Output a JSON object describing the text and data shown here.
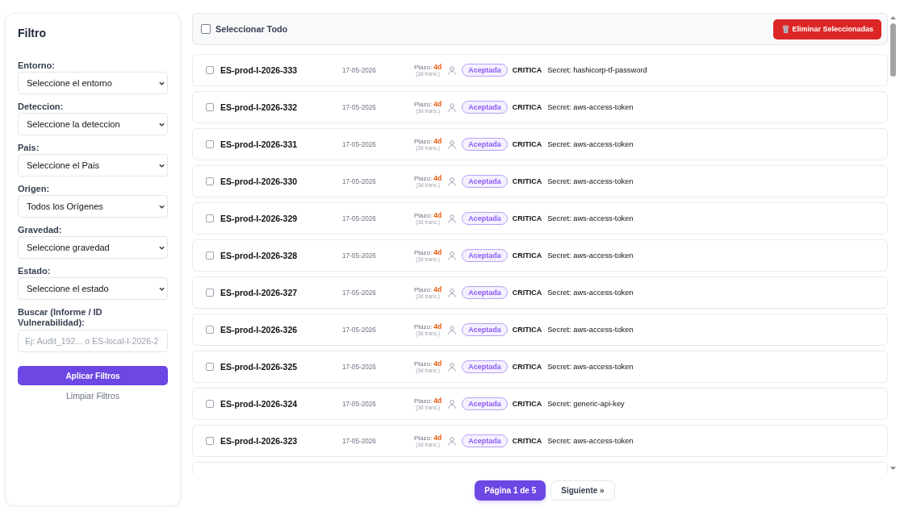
{
  "sidebar": {
    "title": "Filtro",
    "filters": [
      {
        "label": "Entorno:",
        "value": "Seleccione el entorno"
      },
      {
        "label": "Deteccion:",
        "value": "Seleccione la deteccion"
      },
      {
        "label": "Pais:",
        "value": "Seleccione el Pais"
      },
      {
        "label": "Origen:",
        "value": "Todos los Orígenes"
      },
      {
        "label": "Gravedad:",
        "value": "Seleccione gravedad"
      },
      {
        "label": "Estado:",
        "value": "Seleccione el estado"
      }
    ],
    "search": {
      "label": "Buscar (Informe / ID Vulnerabilidad):",
      "placeholder": "Ej: Audit_192... o ES-local-I-2026-2"
    },
    "apply_button": "Aplicar Filtros",
    "clear_link": "Limpiar Filtros"
  },
  "toolbar": {
    "select_all": {
      "label": "Seleccionar Todo",
      "checked": false
    },
    "delete_button": "Eliminar Seleccionadas"
  },
  "results": [
    {
      "checked": false,
      "id": "ES-prod-I-2026-333",
      "date": "17-05-2026",
      "deadline_label": "Plazo:",
      "deadline": "4d",
      "transit": "(3d trans.)",
      "status": "Aceptada",
      "severity": "CRITICA",
      "title": "Secret: hashicorp-tf-password"
    },
    {
      "checked": false,
      "id": "ES-prod-I-2026-332",
      "date": "17-05-2026",
      "deadline_label": "Plazo:",
      "deadline": "4d",
      "transit": "(3d trans.)",
      "status": "Aceptada",
      "severity": "CRITICA",
      "title": "Secret: aws-access-token"
    },
    {
      "checked": false,
      "id": "ES-prod-I-2026-331",
      "date": "17-05-2026",
      "deadline_label": "Plazo:",
      "deadline": "4d",
      "transit": "(3d trans.)",
      "status": "Aceptada",
      "severity": "CRITICA",
      "title": "Secret: aws-access-token"
    },
    {
      "checked": false,
      "id": "ES-prod-I-2026-330",
      "date": "17-05-2026",
      "deadline_label": "Plazo:",
      "deadline": "4d",
      "transit": "(3d trans.)",
      "status": "Aceptada",
      "severity": "CRITICA",
      "title": "Secret: aws-access-token"
    },
    {
      "checked": false,
      "id": "ES-prod-I-2026-329",
      "date": "17-05-2026",
      "deadline_label": "Plazo:",
      "deadline": "4d",
      "transit": "(3d trans.)",
      "status": "Aceptada",
      "severity": "CRITICA",
      "title": "Secret: aws-access-token"
    },
    {
      "checked": false,
      "id": "ES-prod-I-2026-328",
      "date": "17-05-2026",
      "deadline_label": "Plazo:",
      "deadline": "4d",
      "transit": "(3d trans.)",
      "status": "Aceptada",
      "severity": "CRITICA",
      "title": "Secret: aws-access-token"
    },
    {
      "checked": false,
      "id": "ES-prod-I-2026-327",
      "date": "17-05-2026",
      "deadline_label": "Plazo:",
      "deadline": "4d",
      "transit": "(3d trans.)",
      "status": "Aceptada",
      "severity": "CRITICA",
      "title": "Secret: aws-access-token"
    },
    {
      "checked": false,
      "id": "ES-prod-I-2026-326",
      "date": "17-05-2026",
      "deadline_label": "Plazo:",
      "deadline": "4d",
      "transit": "(3d trans.)",
      "status": "Aceptada",
      "severity": "CRITICA",
      "title": "Secret: aws-access-token"
    },
    {
      "checked": false,
      "id": "ES-prod-I-2026-325",
      "date": "17-05-2026",
      "deadline_label": "Plazo:",
      "deadline": "4d",
      "transit": "(3d trans.)",
      "status": "Aceptada",
      "severity": "CRITICA",
      "title": "Secret: aws-access-token"
    },
    {
      "checked": false,
      "id": "ES-prod-I-2026-324",
      "date": "17-05-2026",
      "deadline_label": "Plazo:",
      "deadline": "4d",
      "transit": "(3d trans.)",
      "status": "Aceptada",
      "severity": "CRITICA",
      "title": "Secret: generic-api-key"
    },
    {
      "checked": false,
      "id": "ES-prod-I-2026-323",
      "date": "17-05-2026",
      "deadline_label": "Plazo:",
      "deadline": "4d",
      "transit": "(3d trans.)",
      "status": "Aceptada",
      "severity": "CRITICA",
      "title": "Secret: aws-access-token"
    }
  ],
  "pagination": {
    "current": "Página 1 de 5",
    "next": "Siguiente »"
  }
}
